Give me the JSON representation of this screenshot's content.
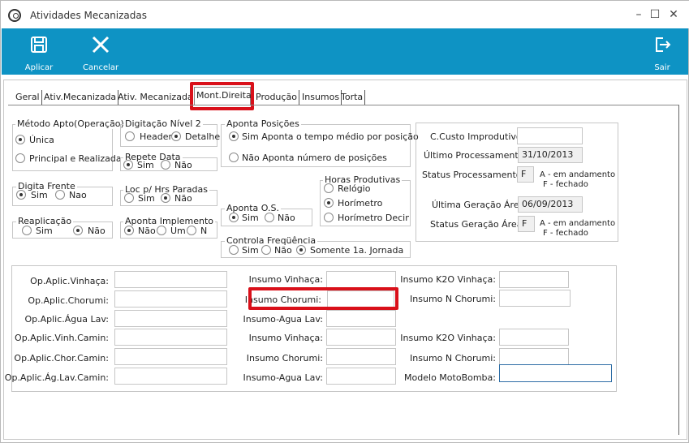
{
  "window": {
    "title": "Atividades Mecanizadas",
    "minimize": "–",
    "maximize": "☐",
    "close": "✕"
  },
  "toolbar": {
    "apply_label": "Aplicar",
    "cancel_label": "Cancelar",
    "exit_label": "Sair"
  },
  "tabs": [
    "Geral",
    "Ativ.Mecanizada",
    "Ativ. Mecanizada",
    "Mont.Direita",
    "Produção",
    "Insumos",
    "Torta"
  ],
  "groups": {
    "metodo_apto": {
      "title": "Método Apto(Operação)",
      "options": [
        "Única",
        "Principal e Realizada"
      ],
      "selected": "Única"
    },
    "digitacao_nivel2": {
      "title": "Digitação Nível 2",
      "options": [
        "Header",
        "Detalhe"
      ],
      "selected": "Detalhe"
    },
    "repete_data": {
      "title": "Repete Data",
      "options": [
        "Sim",
        "Não"
      ],
      "selected": "Sim"
    },
    "aponta_posicoes": {
      "title": "Aponta Posições",
      "options": [
        "Sim  Aponta o tempo médio por posição",
        "Não  Aponta número de posições"
      ],
      "selected": "Sim"
    },
    "digita_frente": {
      "title": "Digita Frente",
      "options": [
        "Sim",
        "Nao"
      ],
      "selected": "Sim"
    },
    "loc_hrs_paradas": {
      "title": "Loc p/ Hrs Paradas",
      "options": [
        "Sim",
        "Não"
      ],
      "selected": "Não"
    },
    "horas_produtivas": {
      "title": "Horas Produtivas",
      "options": [
        "Relógio",
        "Horímetro",
        "Horímetro Decimal"
      ],
      "selected": "Horímetro"
    },
    "aponta_os": {
      "title": "Aponta O.S.",
      "options": [
        "Sim",
        "Não"
      ],
      "selected": "Sim"
    },
    "reaplicacao": {
      "title": "Reaplicação",
      "options": [
        "Sim",
        "Não"
      ],
      "selected": "Não"
    },
    "aponta_implemento": {
      "title": "Aponta Implemento",
      "options": [
        "Não",
        "Um",
        "N"
      ],
      "selected": "Não"
    },
    "controla_frequencia": {
      "title": "Controla Freqüência",
      "options": [
        "Sim",
        "Não",
        "Somente 1a. Jornada"
      ],
      "selected": "Somente 1a. Jornada"
    }
  },
  "status_panel": {
    "ccusto_label": "C.Custo Improdutivo:",
    "ccusto_value": "",
    "ultimo_proc_label": "Último Processamento:",
    "ultimo_proc_value": "31/10/2013",
    "status_proc_label": "Status Processamento:",
    "status_proc_value": "F",
    "status_note_a": "A - em andamento",
    "status_note_f": "F - fechado",
    "ultima_ger_label": "Última Geração Área",
    "ultima_ger_value": "06/09/2013",
    "status_ger_label": "Status Geração Área",
    "status_ger_value": "F"
  },
  "fields": {
    "col1": [
      "Op.Aplic.Vinhaça:",
      "Op.Aplic.Chorumi:",
      "Op.Aplic.Água Lav:",
      "Op.Aplic.Vinh.Camin:",
      "Op.Aplic.Chor.Camin:",
      "Op.Aplic.Ág.Lav.Camin:"
    ],
    "col2": [
      "Insumo Vinhaça:",
      "Insumo Chorumi:",
      "Insumo-Agua Lav:",
      "Insumo Vinhaça:",
      "Insumo Chorumi:",
      "Insumo-Agua Lav:"
    ],
    "col3": [
      "Insumo K2O Vinhaça:",
      "Insumo N Chorumi:",
      "",
      "Insumo K2O Vinhaça:",
      "Insumo N Chorumi:",
      "Modelo MotoBomba:"
    ]
  },
  "colors": {
    "toolbar": "#0e93c4",
    "highlight": "#d9101a"
  }
}
